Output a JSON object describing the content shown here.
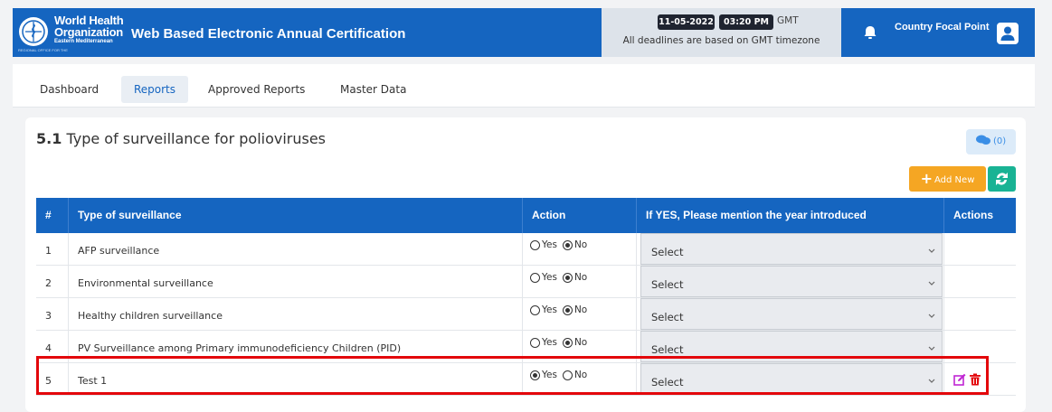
{
  "header": {
    "org_line1": "World Health",
    "org_line2": "Organization",
    "org_region": "Eastern Mediterranean",
    "org_small": "REGIONAL OFFICE FOR THE",
    "app_title": "Web Based Electronic Annual Certification",
    "date": "11-05-2022",
    "time": "03:20 PM",
    "timezone": "GMT",
    "deadline_note": "All deadlines are based on GMT timezone",
    "role": "Country Focal Point",
    "brand_color": "#1565c0"
  },
  "nav": {
    "items": [
      {
        "label": "Dashboard"
      },
      {
        "label": "Reports"
      },
      {
        "label": "Approved Reports"
      },
      {
        "label": "Master Data"
      }
    ],
    "active": "Reports"
  },
  "section": {
    "number": "5.1",
    "title": "Type of surveillance for polioviruses",
    "comments_count": "(0)",
    "add_new_label": "Add New"
  },
  "table": {
    "columns": [
      "#",
      "Type of surveillance",
      "Action",
      "If YES, Please mention the year introduced",
      "Actions"
    ],
    "rows": [
      {
        "num": "1",
        "type": "AFP surveillance",
        "yes_label": "Yes",
        "no_label": "No",
        "selected": "No",
        "year": "Select"
      },
      {
        "num": "2",
        "type": "Environmental surveillance",
        "yes_label": "Yes",
        "no_label": "No",
        "selected": "No",
        "year": "Select"
      },
      {
        "num": "3",
        "type": "Healthy children surveillance",
        "yes_label": "Yes",
        "no_label": "No",
        "selected": "No",
        "year": "Select"
      },
      {
        "num": "4",
        "type": "PV Surveillance among Primary immunodeficiency Children (PID)",
        "yes_label": "Yes",
        "no_label": "No",
        "selected": "No",
        "year": "Select"
      },
      {
        "num": "5",
        "type": "Test 1",
        "yes_label": "Yes",
        "no_label": "No",
        "selected": "Yes",
        "year": "Select"
      }
    ]
  },
  "colors": {
    "header_blue": "#1565c0",
    "add_new": "#f5a623",
    "refresh": "#19b394",
    "highlight": "#e3070b",
    "edit_icon": "#c026d3",
    "delete_icon": "#e3070b"
  }
}
